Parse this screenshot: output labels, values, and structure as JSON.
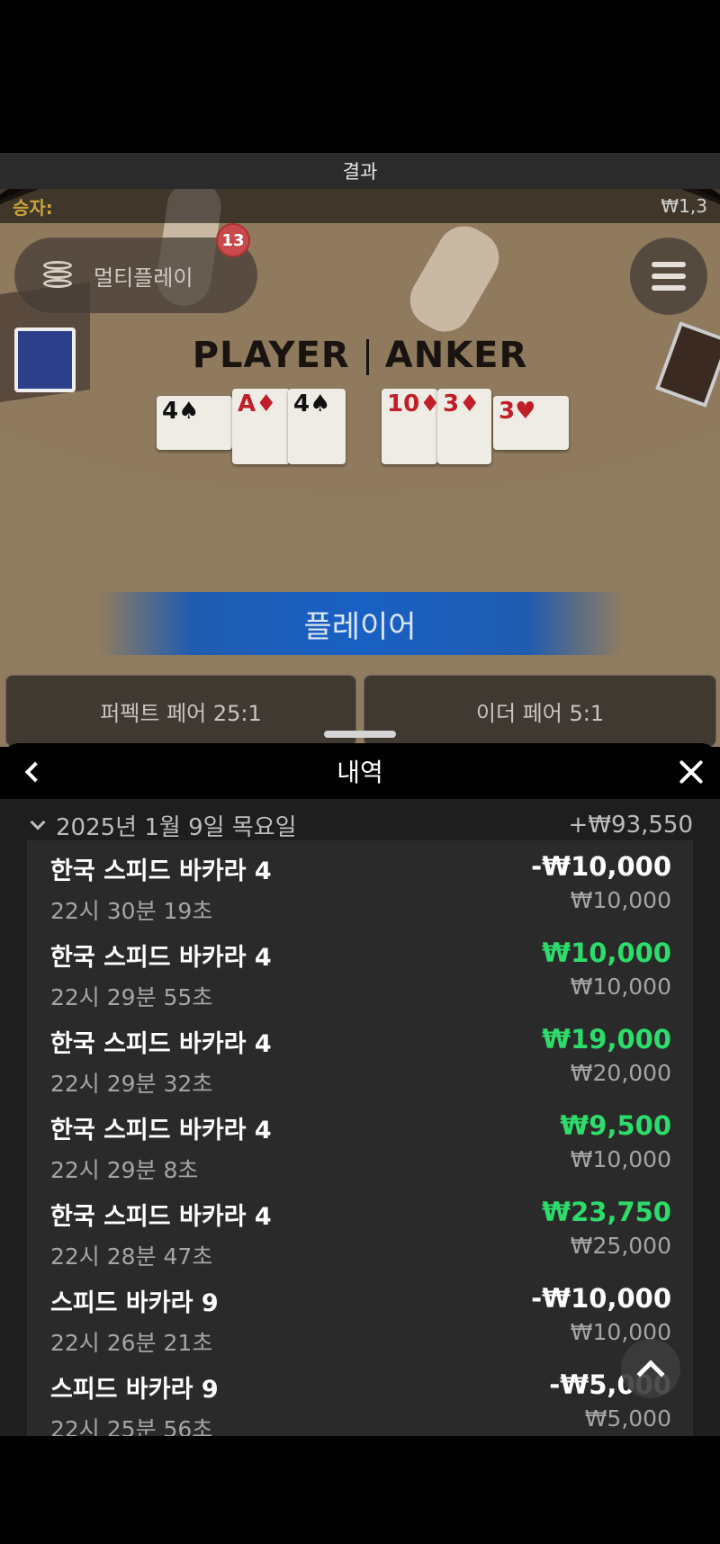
{
  "result_bar": {
    "label": "결과"
  },
  "game": {
    "winner_label": "승자:",
    "winner_amount": "₩1,3",
    "multiplay_label": "멀티플레이",
    "multiplay_badge": "13",
    "table_player": "PLAYER",
    "table_banker": "ANKER",
    "player_cards": [
      {
        "rank": "4",
        "suit": "♠",
        "color": "black"
      },
      {
        "rank": "A",
        "suit": "♦",
        "color": "red"
      },
      {
        "rank": "4",
        "suit": "♠",
        "color": "black"
      }
    ],
    "banker_cards": [
      {
        "rank": "10",
        "suit": "♦",
        "color": "red"
      },
      {
        "rank": "3",
        "suit": "♦",
        "color": "red"
      },
      {
        "rank": "3",
        "suit": "♥",
        "color": "red"
      }
    ],
    "result_banner": "플레이어",
    "bet_perfect_pair": "퍼펙트 페어 25:1",
    "bet_either_pair": "이더 페어 5:1"
  },
  "history": {
    "title": "내역",
    "date_label": "2025년 1월 9일 목요일",
    "date_total": "+₩93,550",
    "items": [
      {
        "title": "한국 스피드 바카라 4",
        "time": "22시 30분 19초",
        "amount": "-₩10,000",
        "stake": "₩10,000",
        "type": "neg"
      },
      {
        "title": "한국 스피드 바카라 4",
        "time": "22시 29분 55초",
        "amount": "₩10,000",
        "stake": "₩10,000",
        "type": "pos"
      },
      {
        "title": "한국 스피드 바카라 4",
        "time": "22시 29분 32초",
        "amount": "₩19,000",
        "stake": "₩20,000",
        "type": "pos"
      },
      {
        "title": "한국 스피드 바카라 4",
        "time": "22시 29분 8초",
        "amount": "₩9,500",
        "stake": "₩10,000",
        "type": "pos"
      },
      {
        "title": "한국 스피드 바카라 4",
        "time": "22시 28분 47초",
        "amount": "₩23,750",
        "stake": "₩25,000",
        "type": "pos"
      },
      {
        "title": "스피드 바카라 9",
        "time": "22시 26분 21초",
        "amount": "-₩10,000",
        "stake": "₩10,000",
        "type": "neg"
      },
      {
        "title": "스피드 바카라 9",
        "time": "22시 25분 56초",
        "amount": "-₩5,000",
        "stake": "₩5,000",
        "type": "neg"
      }
    ]
  },
  "colors": {
    "positive": "#2ddc6a",
    "negative": "#ffffff",
    "banner": "#1960c4",
    "winner_label": "#c9a43b",
    "badge": "#c84a4a"
  }
}
